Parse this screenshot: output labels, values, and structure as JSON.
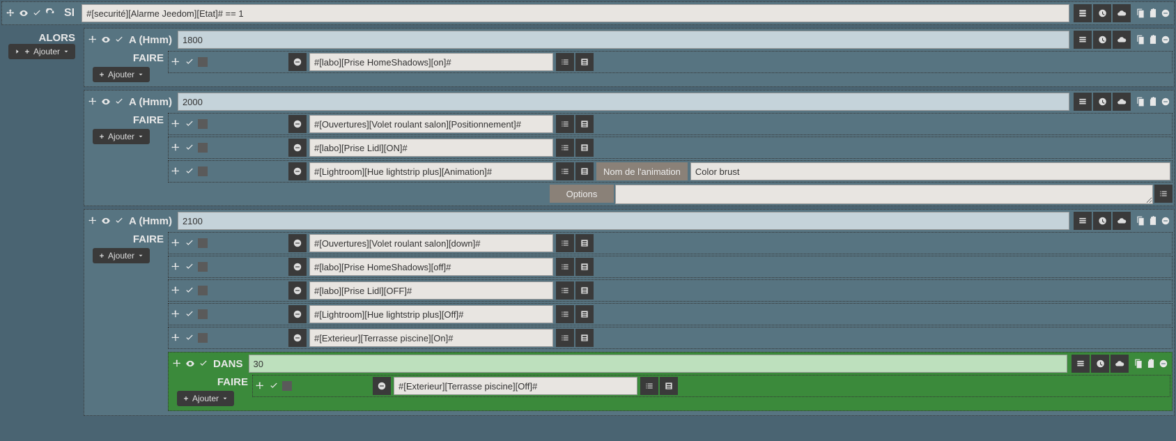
{
  "si": {
    "label": "SI",
    "condition": "#[securité][Alarme Jeedom][Etat]# == 1"
  },
  "alors": {
    "label": "ALORS"
  },
  "ajouter": {
    "label": "Ajouter"
  },
  "faire": {
    "label": "FAIRE"
  },
  "a_label": "A (Hmm)",
  "dans_label": "DANS",
  "blocks": [
    {
      "time": "1800",
      "actions": [
        {
          "cmd": "#[labo][Prise HomeShadows][on]#"
        }
      ]
    },
    {
      "time": "2000",
      "actions": [
        {
          "cmd": "#[Ouvertures][Volet roulant salon][Positionnement]#"
        },
        {
          "cmd": "#[labo][Prise Lidl][ON]#"
        },
        {
          "cmd": "#[Lightroom][Hue lightstrip plus][Animation]#",
          "anim_name_label": "Nom de l'animation",
          "anim_value": "Color brust",
          "options_label": "Options",
          "options_value": ""
        }
      ]
    },
    {
      "time": "2100",
      "actions": [
        {
          "cmd": "#[Ouvertures][Volet roulant salon][down]#"
        },
        {
          "cmd": "#[labo][Prise HomeShadows][off]#"
        },
        {
          "cmd": "#[labo][Prise Lidl][OFF]#"
        },
        {
          "cmd": "#[Lightroom][Hue lightstrip plus][Off]#"
        },
        {
          "cmd": "#[Exterieur][Terrasse piscine][On]#"
        }
      ],
      "dans": {
        "delay": "30",
        "actions": [
          {
            "cmd": "#[Exterieur][Terrasse piscine][Off]#"
          }
        ]
      }
    }
  ]
}
